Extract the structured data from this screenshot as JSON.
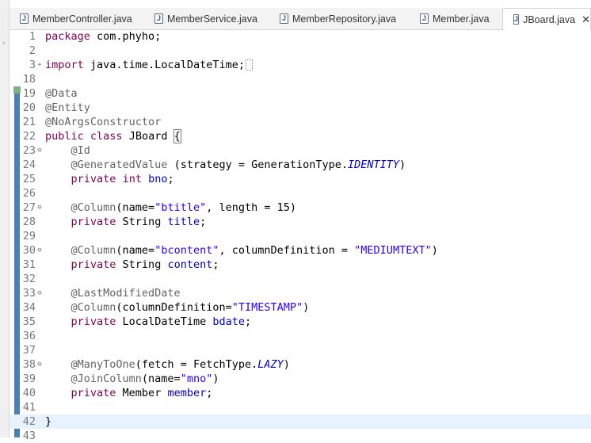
{
  "tabs": [
    {
      "label": "MemberController.java",
      "icon": "java-file-icon",
      "active": false
    },
    {
      "label": "MemberService.java",
      "icon": "java-file-icon",
      "active": false
    },
    {
      "label": "MemberRepository.java",
      "icon": "java-file-icon",
      "active": false
    },
    {
      "label": "Member.java",
      "icon": "java-file-icon",
      "active": false
    },
    {
      "label": "JBoard.java",
      "icon": "java-file-icon",
      "active": true
    }
  ],
  "close_glyph": "✕",
  "java_icon_letter": "J",
  "editor": {
    "lines": [
      {
        "num": "1",
        "fold": "",
        "tokens": [
          {
            "t": "package",
            "c": "kw"
          },
          {
            "t": " com.phyho;",
            "c": ""
          }
        ]
      },
      {
        "num": "2",
        "fold": "",
        "tokens": []
      },
      {
        "num": "3",
        "fold": "+",
        "tokens": [
          {
            "t": "import",
            "c": "kw"
          },
          {
            "t": " java.time.LocalDateTime;",
            "c": ""
          }
        ],
        "collapsed": true
      },
      {
        "num": "18",
        "fold": "",
        "tokens": []
      },
      {
        "num": "19",
        "fold": "",
        "tokens": [
          {
            "t": "@Data",
            "c": "ann"
          }
        ]
      },
      {
        "num": "20",
        "fold": "",
        "tokens": [
          {
            "t": "@Entity",
            "c": "ann"
          }
        ]
      },
      {
        "num": "21",
        "fold": "",
        "tokens": [
          {
            "t": "@NoArgsConstructor",
            "c": "ann"
          }
        ]
      },
      {
        "num": "22",
        "fold": "",
        "tokens": [
          {
            "t": "public",
            "c": "kw"
          },
          {
            "t": " ",
            "c": ""
          },
          {
            "t": "class",
            "c": "kw"
          },
          {
            "t": " JBoard ",
            "c": ""
          },
          {
            "t": "{",
            "c": "brace"
          }
        ]
      },
      {
        "num": "23",
        "fold": "⊖",
        "tokens": [
          {
            "t": "    ",
            "c": ""
          },
          {
            "t": "@Id",
            "c": "ann"
          }
        ]
      },
      {
        "num": "24",
        "fold": "",
        "tokens": [
          {
            "t": "    ",
            "c": ""
          },
          {
            "t": "@GeneratedValue",
            "c": "ann"
          },
          {
            "t": " (strategy = GenerationType.",
            "c": ""
          },
          {
            "t": "IDENTITY",
            "c": "enumc"
          },
          {
            "t": ")",
            "c": ""
          }
        ]
      },
      {
        "num": "25",
        "fold": "",
        "tokens": [
          {
            "t": "    ",
            "c": ""
          },
          {
            "t": "private",
            "c": "kw"
          },
          {
            "t": " ",
            "c": ""
          },
          {
            "t": "int",
            "c": "kw"
          },
          {
            "t": " ",
            "c": ""
          },
          {
            "t": "bno",
            "c": "field"
          },
          {
            "t": ";",
            "c": ""
          }
        ]
      },
      {
        "num": "26",
        "fold": "",
        "tokens": []
      },
      {
        "num": "27",
        "fold": "⊖",
        "tokens": [
          {
            "t": "    ",
            "c": ""
          },
          {
            "t": "@Column",
            "c": "ann"
          },
          {
            "t": "(name=",
            "c": ""
          },
          {
            "t": "\"btitle\"",
            "c": "str"
          },
          {
            "t": ", length = 15)",
            "c": ""
          }
        ]
      },
      {
        "num": "28",
        "fold": "",
        "tokens": [
          {
            "t": "    ",
            "c": ""
          },
          {
            "t": "private",
            "c": "kw"
          },
          {
            "t": " String ",
            "c": ""
          },
          {
            "t": "title",
            "c": "field"
          },
          {
            "t": ";",
            "c": ""
          }
        ]
      },
      {
        "num": "29",
        "fold": "",
        "tokens": []
      },
      {
        "num": "30",
        "fold": "⊖",
        "tokens": [
          {
            "t": "    ",
            "c": ""
          },
          {
            "t": "@Column",
            "c": "ann"
          },
          {
            "t": "(name=",
            "c": ""
          },
          {
            "t": "\"bcontent\"",
            "c": "str"
          },
          {
            "t": ", columnDefinition = ",
            "c": ""
          },
          {
            "t": "\"MEDIUMTEXT\"",
            "c": "str"
          },
          {
            "t": ")",
            "c": ""
          }
        ]
      },
      {
        "num": "31",
        "fold": "",
        "tokens": [
          {
            "t": "    ",
            "c": ""
          },
          {
            "t": "private",
            "c": "kw"
          },
          {
            "t": " String ",
            "c": ""
          },
          {
            "t": "content",
            "c": "field"
          },
          {
            "t": ";",
            "c": ""
          }
        ]
      },
      {
        "num": "32",
        "fold": "",
        "tokens": []
      },
      {
        "num": "33",
        "fold": "⊖",
        "tokens": [
          {
            "t": "    ",
            "c": ""
          },
          {
            "t": "@LastModifiedDate",
            "c": "ann"
          }
        ]
      },
      {
        "num": "34",
        "fold": "",
        "tokens": [
          {
            "t": "    ",
            "c": ""
          },
          {
            "t": "@Column",
            "c": "ann"
          },
          {
            "t": "(columnDefinition=",
            "c": ""
          },
          {
            "t": "\"TIMESTAMP\"",
            "c": "str"
          },
          {
            "t": ")",
            "c": ""
          }
        ]
      },
      {
        "num": "35",
        "fold": "",
        "tokens": [
          {
            "t": "    ",
            "c": ""
          },
          {
            "t": "private",
            "c": "kw"
          },
          {
            "t": " LocalDateTime ",
            "c": ""
          },
          {
            "t": "bdate",
            "c": "field"
          },
          {
            "t": ";",
            "c": ""
          }
        ]
      },
      {
        "num": "36",
        "fold": "",
        "tokens": []
      },
      {
        "num": "37",
        "fold": "",
        "tokens": []
      },
      {
        "num": "38",
        "fold": "⊖",
        "tokens": [
          {
            "t": "    ",
            "c": ""
          },
          {
            "t": "@ManyToOne",
            "c": "ann"
          },
          {
            "t": "(fetch = FetchType.",
            "c": ""
          },
          {
            "t": "LAZY",
            "c": "enumc"
          },
          {
            "t": ")",
            "c": ""
          }
        ]
      },
      {
        "num": "39",
        "fold": "",
        "tokens": [
          {
            "t": "    ",
            "c": ""
          },
          {
            "t": "@JoinColumn",
            "c": "ann"
          },
          {
            "t": "(name=",
            "c": ""
          },
          {
            "t": "\"mno\"",
            "c": "str"
          },
          {
            "t": ")",
            "c": ""
          }
        ]
      },
      {
        "num": "40",
        "fold": "",
        "tokens": [
          {
            "t": "    ",
            "c": ""
          },
          {
            "t": "private",
            "c": "kw"
          },
          {
            "t": " Member ",
            "c": ""
          },
          {
            "t": "member",
            "c": "field"
          },
          {
            "t": ";",
            "c": ""
          }
        ]
      },
      {
        "num": "41",
        "fold": "",
        "tokens": []
      },
      {
        "num": "42",
        "fold": "",
        "tokens": [
          {
            "t": "}",
            "c": ""
          }
        ],
        "current": true
      },
      {
        "num": "43",
        "fold": "",
        "tokens": []
      }
    ]
  }
}
